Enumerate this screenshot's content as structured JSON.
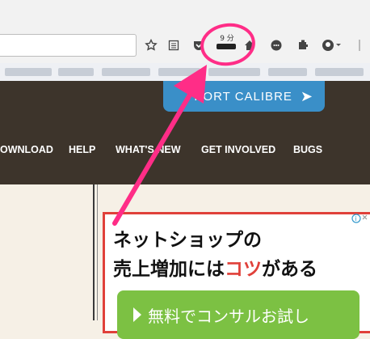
{
  "browser": {
    "url_value": "",
    "timer_label": "9 分",
    "icons": [
      "star-icon",
      "reading-list-icon",
      "pocket-icon",
      "timer-extension-icon",
      "home-icon",
      "chat-icon",
      "extension-icon",
      "profile-icon",
      "menu-icon"
    ]
  },
  "site": {
    "support_label": "PORT CALIBRE",
    "support_arrow": "➤",
    "nav": [
      "OWNLOAD",
      "HELP",
      "WHAT'S NEW",
      "GET INVOLVED",
      "BUGS"
    ]
  },
  "ad": {
    "line1": "ネットショップの",
    "line2_pre": "売上増加には",
    "line2_red": "コツ",
    "line2_post": "がある",
    "button_text": "無料でコンサルお試し",
    "choice_label": "i"
  },
  "colors": {
    "header_bg": "#3d342b",
    "support_bg": "#3a8fc8",
    "ad_border": "#e0413a",
    "ad_button": "#7cc143",
    "annotation": "#ff2d87"
  }
}
